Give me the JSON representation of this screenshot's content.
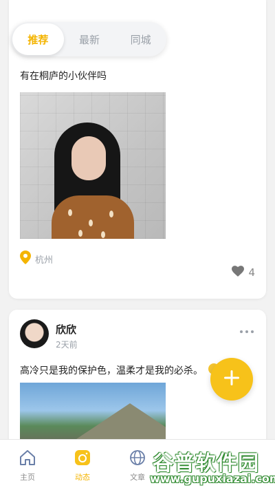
{
  "tabs": [
    {
      "label": "推荐",
      "active": true
    },
    {
      "label": "最新",
      "active": false
    },
    {
      "label": "同城",
      "active": false
    }
  ],
  "post1": {
    "text": "有在桐庐的小伙伴吗",
    "location": "杭州",
    "like_count": "4",
    "location_icon": "map-pin-icon",
    "like_icon": "heart-icon"
  },
  "post2": {
    "author": "欣欣",
    "time": "2天前",
    "text": "高冷只是我的保护色，温柔才是我的必杀。"
  },
  "fab": {
    "icon": "plus-icon",
    "color": "#f7c21a"
  },
  "bottom_nav": [
    {
      "label": "主页",
      "icon": "home-icon",
      "active": false
    },
    {
      "label": "动态",
      "icon": "camera-icon",
      "active": true
    },
    {
      "label": "文章",
      "icon": "globe-icon",
      "active": false
    }
  ],
  "watermark": {
    "title": "谷普软件园",
    "url": "www.gupuxiazai.com"
  },
  "colors": {
    "accent": "#f4b400",
    "muted": "#9aa0a8",
    "background": "#f2f2f2"
  }
}
